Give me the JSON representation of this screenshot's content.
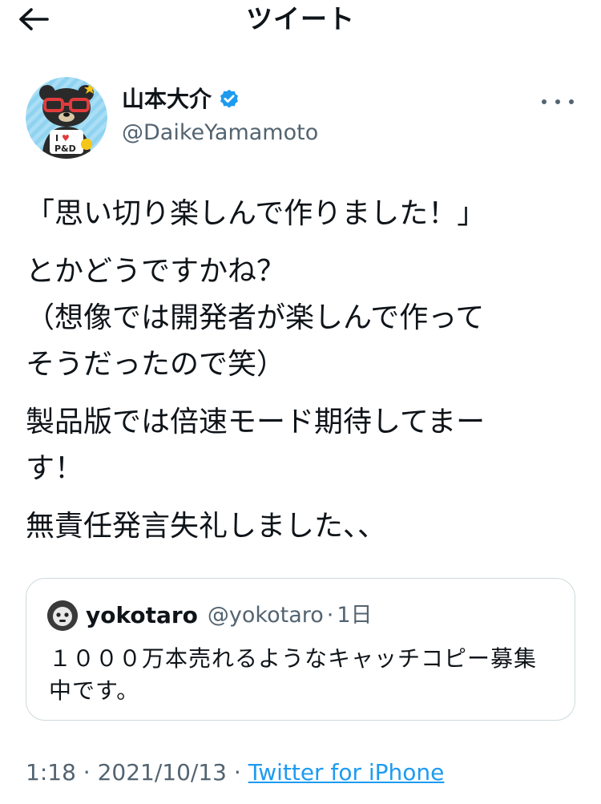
{
  "header": {
    "title": "ツイート",
    "back_icon": "arrow-left-icon"
  },
  "author": {
    "display_name": "山本大介",
    "handle": "@DaikeYamamoto",
    "verified": true,
    "avatar_icon": "bear-avatar-icon",
    "avatar_shirt_text": "I ♥ P&D"
  },
  "tweet": {
    "paragraphs": [
      "「思い切り楽しんで作りました！」",
      "とかどうですかね？\n（想像では開発者が楽しんで作って\nそうだったので笑）",
      "製品版では倍速モード期待してまー\nす！",
      "無責任発言失礼しました、、"
    ]
  },
  "quote": {
    "name": "yokotaro",
    "handle": "@yokotaro",
    "separator": "·",
    "time": "1日",
    "text": "１０００万本売れるようなキャッチコピー募集中です。",
    "avatar_icon": "mask-avatar-icon"
  },
  "meta": {
    "time": "1:18",
    "date": "2021/10/13",
    "separator": "·",
    "source": "Twitter for iPhone"
  },
  "colors": {
    "text": "#0f1419",
    "secondary": "#536471",
    "link": "#1d9bf0",
    "border": "#cfd9de"
  }
}
